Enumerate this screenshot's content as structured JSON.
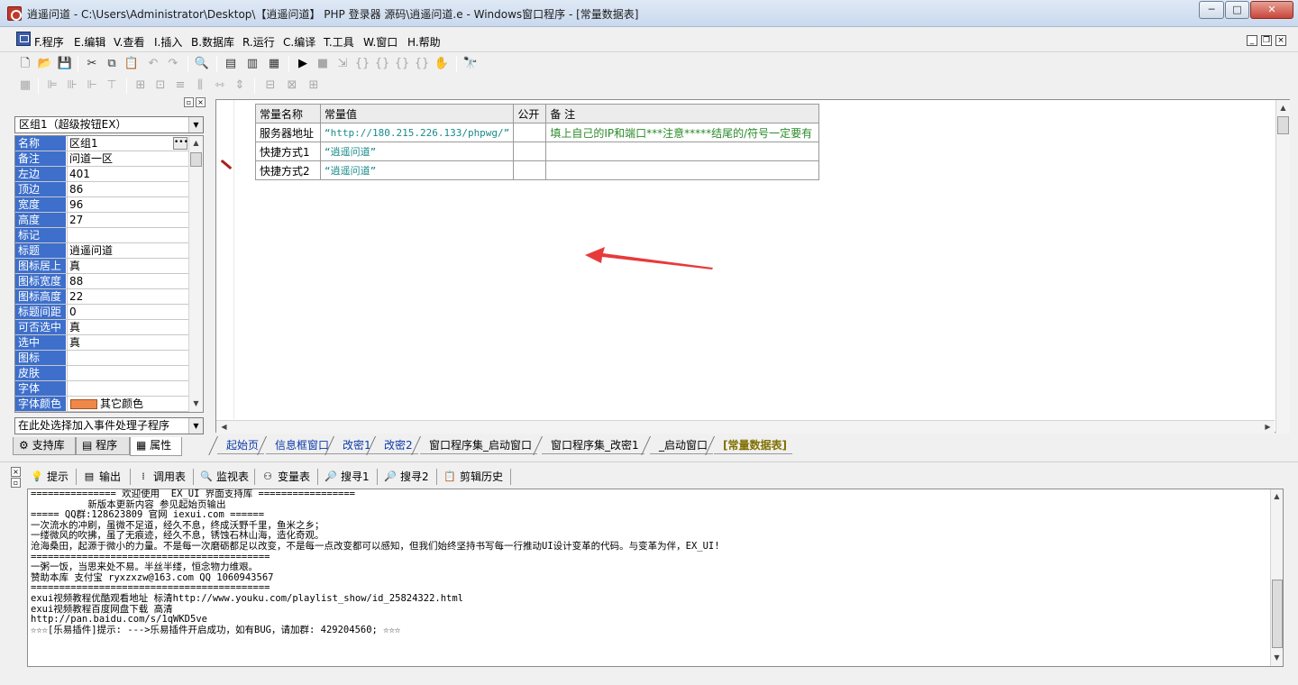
{
  "window": {
    "title": "逍遥问道 - C:\\Users\\Administrator\\Desktop\\【逍遥问道】 PHP 登录器 源码\\逍遥问道.e - Windows窗口程序 - [常量数据表]",
    "min_label": "─",
    "max_label": "□",
    "close_label": "✕"
  },
  "menu": {
    "items": [
      "F.程序",
      "E.编辑",
      "V.查看",
      "I.插入",
      "B.数据库",
      "R.运行",
      "C.编译",
      "T.工具",
      "W.窗口",
      "H.帮助"
    ]
  },
  "left_panel": {
    "component_combo": "区组1（超级按钮EX）",
    "properties": [
      {
        "name": "名称",
        "value": "区组1"
      },
      {
        "name": "备注",
        "value": "问道一区"
      },
      {
        "name": "左边",
        "value": "401"
      },
      {
        "name": "顶边",
        "value": "86"
      },
      {
        "name": "宽度",
        "value": "96"
      },
      {
        "name": "高度",
        "value": "27"
      },
      {
        "name": "标记",
        "value": ""
      },
      {
        "name": "标题",
        "value": "逍遥问道"
      },
      {
        "name": "图标居上",
        "value": "真"
      },
      {
        "name": "图标宽度",
        "value": "88"
      },
      {
        "name": "图标高度",
        "value": "22"
      },
      {
        "name": "标题间距",
        "value": "0"
      },
      {
        "name": "可否选中",
        "value": "真"
      },
      {
        "name": "选中",
        "value": "真"
      },
      {
        "name": "图标",
        "value": ""
      },
      {
        "name": "皮肤",
        "value": ""
      },
      {
        "name": "字体",
        "value": ""
      },
      {
        "name": "字体颜色",
        "value": "其它颜色"
      }
    ],
    "font_color_swatch": "#f0874a",
    "event_combo": "在此处选择加入事件处理子程序",
    "tabs": [
      "支持库",
      "程序",
      "属性"
    ]
  },
  "const_table": {
    "headers": [
      "常量名称",
      "常量值",
      "公开",
      "备 注"
    ],
    "rows": [
      {
        "name": "服务器地址",
        "value": "“http://180.215.226.133/phpwg/”",
        "public": "",
        "note": "填上自己的IP和端口***注意*****结尾的/符号一定要有"
      },
      {
        "name": "快捷方式1",
        "value": "“逍遥问道”",
        "public": "",
        "note": ""
      },
      {
        "name": "快捷方式2",
        "value": "“逍遥问道”",
        "public": "",
        "note": ""
      }
    ]
  },
  "editor_tabs": [
    "起始页",
    "信息框窗口",
    "改密1",
    "改密2",
    "窗口程序集_启动窗口",
    "窗口程序集_改密1",
    "_启动窗口",
    "[常量数据表]"
  ],
  "bottom_tabs": [
    "提示",
    "输出",
    "调用表",
    "监视表",
    "变量表",
    "搜寻1",
    "搜寻2",
    "剪辑历史"
  ],
  "output_lines": [
    "=============== 欢迎使用  EX_UI 界面支持库 =================",
    "          新版本更新内容 参见起始页输出",
    "===== QQ群:128623809 官网 iexui.com ======",
    "一次流水的冲刷，虽微不足道，经久不息，终成沃野千里，鱼米之乡；",
    "一缕微风的吹拂，虽了无痕迹，经久不息，锈蚀石林山海，造化奇观。",
    "沧海桑田，起源于微小的力量。不是每一次磨砺都足以改变，不是每一点改变都可以感知，但我们始终坚持书写每一行推动UI设计变革的代码。与变革为伴，EX_UI!",
    "==========================================",
    "一粥一饭，当思来处不易。半丝半缕，恒念物力维艰。",
    "赞助本库 支付宝 ryxzxzw@163.com QQ 1060943567",
    "==========================================",
    "exui视频教程优酷观看地址 标清http://www.youku.com/playlist_show/id_25824322.html",
    "exui视频教程百度网盘下载 高清",
    "http://pan.baidu.com/s/1qWKD5ve",
    "☆☆☆[乐易插件]提示: --->乐易插件开启成功，如有BUG，请加群: 429204560; ☆☆☆"
  ],
  "colors": {
    "property_name_bg": "#3d6fcb",
    "const_value_color": "#1a8a8a",
    "note_color": "#2a8a2a",
    "active_tab_color": "#807000",
    "arrow_color": "#e83a3a"
  }
}
